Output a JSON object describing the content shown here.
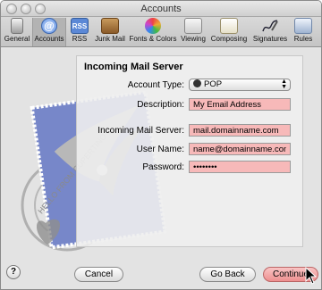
{
  "window": {
    "title": "Accounts"
  },
  "toolbar": {
    "items": [
      {
        "label": "General",
        "icon": "switch-icon"
      },
      {
        "label": "Accounts",
        "icon": "at-sign-icon"
      },
      {
        "label": "RSS",
        "icon": "rss-icon"
      },
      {
        "label": "Junk Mail",
        "icon": "junk-mail-icon"
      },
      {
        "label": "Fonts & Colors",
        "icon": "fonts-colors-icon"
      },
      {
        "label": "Viewing",
        "icon": "viewing-icon"
      },
      {
        "label": "Composing",
        "icon": "composing-icon"
      },
      {
        "label": "Signatures",
        "icon": "signatures-icon"
      },
      {
        "label": "Rules",
        "icon": "rules-icon"
      }
    ],
    "selected": "Accounts"
  },
  "panel": {
    "heading": "Incoming Mail Server",
    "account_type": {
      "label": "Account Type:",
      "value": "POP"
    },
    "description": {
      "label": "Description:",
      "value": "My Email Address"
    },
    "server": {
      "label": "Incoming Mail Server:",
      "value": "mail.domainname.com"
    },
    "username": {
      "label": "User Name:",
      "value": "name@domainname.com"
    },
    "password": {
      "label": "Password:",
      "value": "••••••••"
    }
  },
  "stamp": {
    "text": "HELLO FROM CUPERTINO"
  },
  "buttons": {
    "help": "?",
    "cancel": "Cancel",
    "back": "Go Back",
    "continue": "Continue"
  },
  "colors": {
    "field_highlight": "#f7b9b9",
    "continue_button": "#ee8f8f"
  }
}
